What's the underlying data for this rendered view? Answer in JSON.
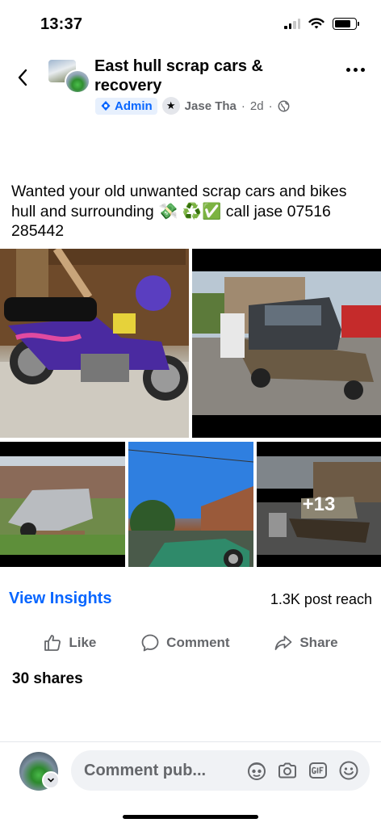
{
  "status_bar": {
    "time": "13:37",
    "icons": [
      "cellular-signal-icon",
      "wifi-icon",
      "battery-icon"
    ],
    "battery_level": 0.8
  },
  "header": {
    "group_name": "East hull scrap cars & recovery",
    "admin_badge": "Admin",
    "author": "Jase Tha",
    "time": "2d",
    "separator": "·",
    "icons": [
      "back-chevron-icon",
      "shield-admin-icon",
      "star-icon",
      "globe-icon",
      "more-dots-icon"
    ]
  },
  "post": {
    "text": "Wanted your old unwanted scrap  cars and bikes  hull and surrounding 💸 ♻️✅  call jase 07516 285442",
    "photos": [
      {
        "subject": "purple motorbike on gravel"
      },
      {
        "subject": "grey hatchback on recovery truck"
      },
      {
        "subject": "silver car on driveway"
      },
      {
        "subject": "green car under blue sky"
      },
      {
        "subject": "car on flatbed truck",
        "overlay": "+13"
      }
    ]
  },
  "insights": {
    "view_label": "View Insights",
    "reach_label": "1.3K post reach"
  },
  "actions": {
    "like": "Like",
    "comment": "Comment",
    "share": "Share"
  },
  "shares_label": "30 shares",
  "comment_bar": {
    "placeholder": "Comment pub...",
    "icons": [
      "avatar-sticker-icon",
      "camera-icon",
      "gif-icon",
      "emoji-icon"
    ]
  },
  "colors": {
    "accent": "#0866ff",
    "secondary_text": "#65676b",
    "input_bg": "#f0f2f5"
  }
}
